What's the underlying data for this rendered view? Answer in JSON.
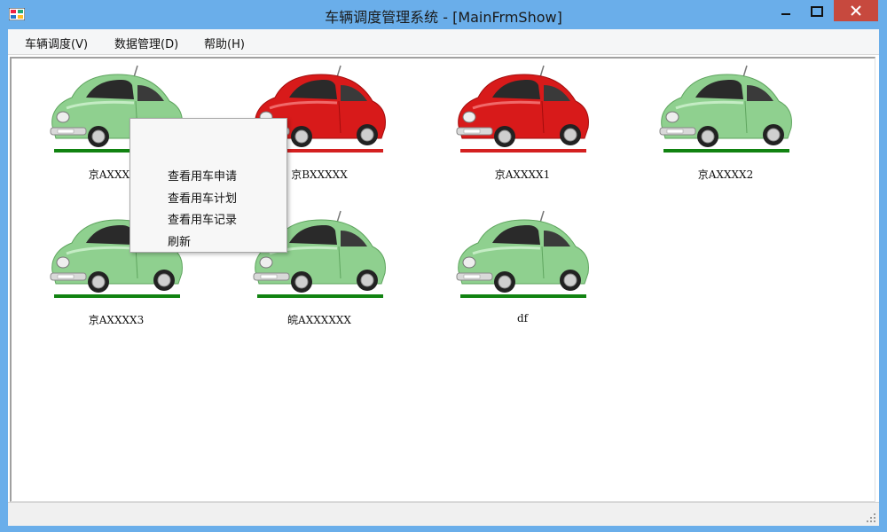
{
  "window": {
    "title": "车辆调度管理系统 - [MainFrmShow]"
  },
  "menu": [
    {
      "label": "车辆调度(V)"
    },
    {
      "label": "数据管理(D)"
    },
    {
      "label": "帮助(H)"
    }
  ],
  "vehicles": [
    {
      "plate": "京AXXXX1",
      "color": "green",
      "bar": "#118311"
    },
    {
      "plate": "京BXXXXX",
      "color": "red",
      "bar": "#d42020"
    },
    {
      "plate": "京AXXXX1",
      "color": "red",
      "bar": "#d42020"
    },
    {
      "plate": "京AXXXX2",
      "color": "green",
      "bar": "#118311"
    },
    {
      "plate": "京AXXXX3",
      "color": "green",
      "bar": "#118311"
    },
    {
      "plate": "皖AXXXXXX",
      "color": "green",
      "bar": "#118311"
    },
    {
      "plate": "df",
      "color": "green",
      "bar": "#118311"
    }
  ],
  "context_menu": [
    {
      "label": "查看用车申请"
    },
    {
      "label": "查看用车计划"
    },
    {
      "label": "查看用车记录"
    },
    {
      "label": "刷新"
    }
  ],
  "colors": {
    "green_car": "#8fd08f",
    "red_car": "#d81a1a",
    "titlebar": "#6aaeea"
  },
  "icons": {
    "app": "app-icon",
    "minimize": "minimize-icon",
    "maximize": "maximize-icon",
    "close": "close-icon"
  }
}
